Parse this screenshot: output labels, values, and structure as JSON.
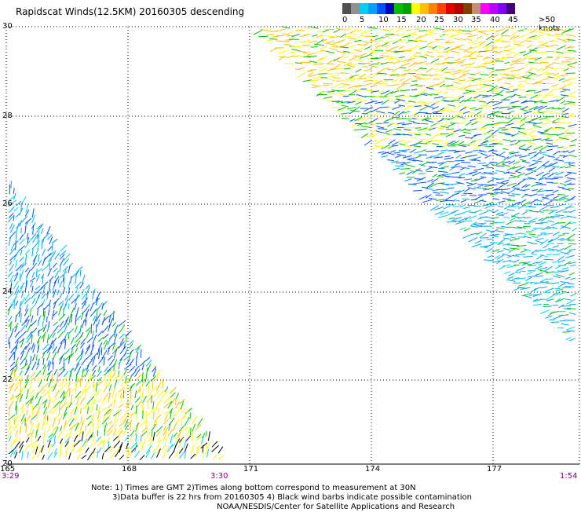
{
  "title": "Rapidscat Winds(12.5KM) 20160305 descending",
  "color_scale": {
    "colors": [
      "#505050",
      "#909090",
      "#00d0f0",
      "#00a0ff",
      "#0050ff",
      "#0000c0",
      "#00c000",
      "#00a000",
      "#ffff00",
      "#ffc000",
      "#ff8000",
      "#ff4000",
      "#e00000",
      "#b00000",
      "#804000",
      "#c09070",
      "#ff00ff",
      "#c000ff",
      "#8000ff",
      "#400080"
    ],
    "labels": [
      "0",
      "5",
      "10",
      "15",
      "20",
      "25",
      "30",
      "35",
      "40",
      "45",
      ">50 knots"
    ]
  },
  "axes": {
    "lat_labels": [
      "30",
      "28",
      "26",
      "24",
      "22",
      "20"
    ],
    "lon_labels": [
      "165",
      "168",
      "171",
      "174",
      "177"
    ]
  },
  "times": {
    "left": "3:29",
    "mid": "3:30",
    "right": "1:54"
  },
  "notes": [
    "Note: 1) Times are GMT 2)Times along bottom correspond to measurement at 30N",
    "3)Data buffer is 22 hrs from 20160305 4) Black wind barbs indicate possible contamination",
    "NOAA/NESDIS/Center for Satellite Applications and Research"
  ]
}
